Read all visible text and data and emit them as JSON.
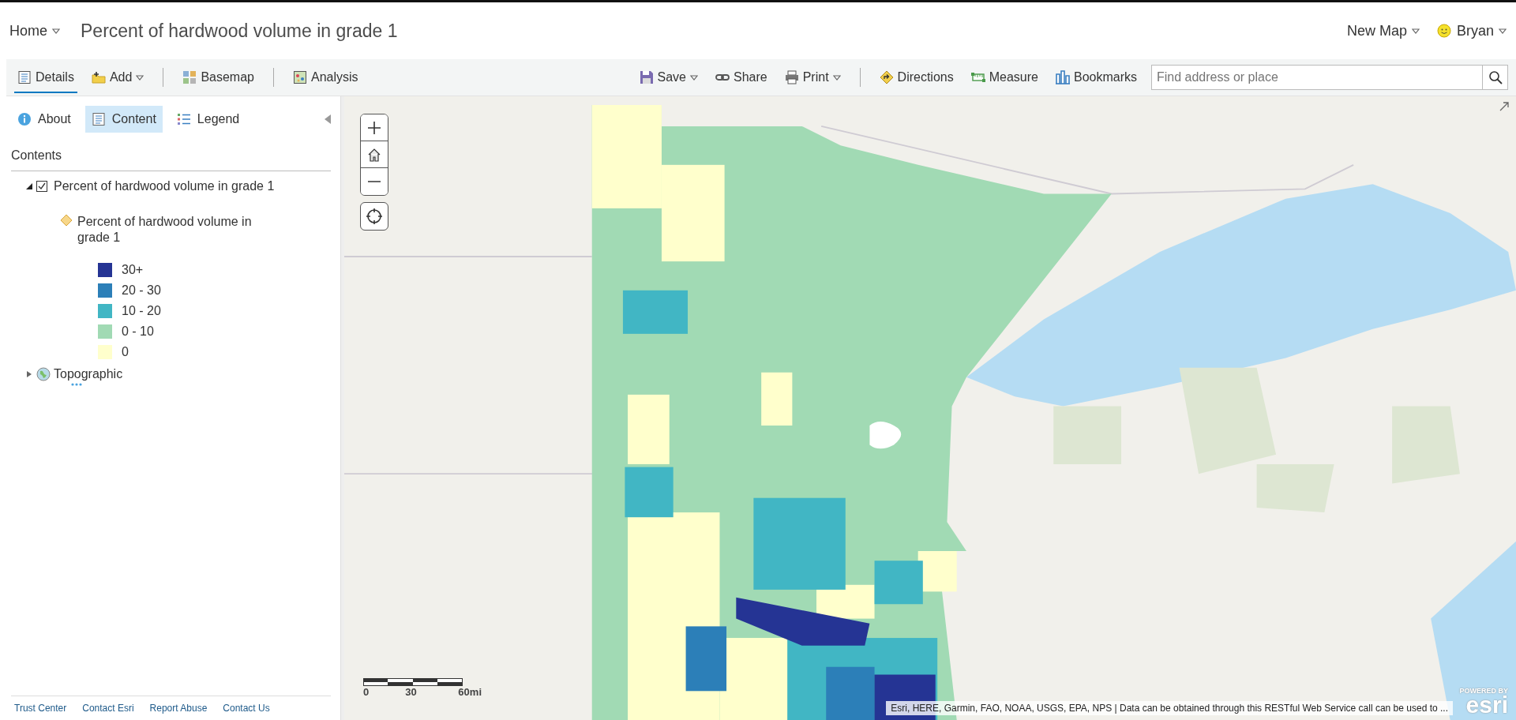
{
  "header": {
    "home_menu": "Home",
    "title": "Percent of hardwood volume in grade 1",
    "new_map_menu": "New Map",
    "user_menu": "Bryan"
  },
  "toolbar": {
    "left_groups": [
      [
        {
          "label": "Details",
          "kind": "tab",
          "selected": true
        },
        {
          "label": "Add",
          "kind": "dropdown"
        }
      ],
      [
        {
          "label": "Basemap",
          "kind": "button"
        }
      ],
      [
        {
          "label": "Analysis",
          "kind": "button"
        }
      ]
    ],
    "right_groups": [
      [
        {
          "label": "Save",
          "kind": "dropdown"
        },
        {
          "label": "Share",
          "kind": "button"
        },
        {
          "label": "Print",
          "kind": "dropdown"
        }
      ],
      [
        {
          "label": "Directions",
          "kind": "button"
        },
        {
          "label": "Measure",
          "kind": "button"
        },
        {
          "label": "Bookmarks",
          "kind": "button"
        }
      ]
    ],
    "search": {
      "placeholder": "Find address or place"
    }
  },
  "panel": {
    "tabs": [
      {
        "label": "About",
        "selected": false
      },
      {
        "label": "Content",
        "selected": true
      },
      {
        "label": "Legend",
        "selected": false
      }
    ],
    "heading": "Contents",
    "layers": [
      {
        "name": "Percent of hardwood volume in grade 1",
        "kind": "layer",
        "expanded": true,
        "checked": true,
        "children": [
          {
            "name": "Percent of hardwood volume in grade 1",
            "legend": [
              {
                "label": "30+",
                "color": "#253494"
              },
              {
                "label": "20 - 30",
                "color": "#2c7fb8"
              },
              {
                "label": "10 - 20",
                "color": "#41b6c4"
              },
              {
                "label": "0 - 10",
                "color": "#a1dab4"
              },
              {
                "label": "0",
                "color": "#ffffcc"
              }
            ]
          }
        ]
      },
      {
        "name": "Topographic",
        "kind": "basemap",
        "expanded": false
      }
    ],
    "footer_links": [
      "Trust Center",
      "Contact Esri",
      "Report Abuse",
      "Contact Us"
    ]
  },
  "map": {
    "scale_bar": [
      "0",
      "30",
      "60mi"
    ],
    "attribution": "Esri, HERE, Garmin, FAO, NOAA, USGS, EPA, NPS | Data can be obtained through this RESTful Web Service call can be used to ...",
    "logo": {
      "tagline": "POWERED BY",
      "word": "esri"
    }
  }
}
